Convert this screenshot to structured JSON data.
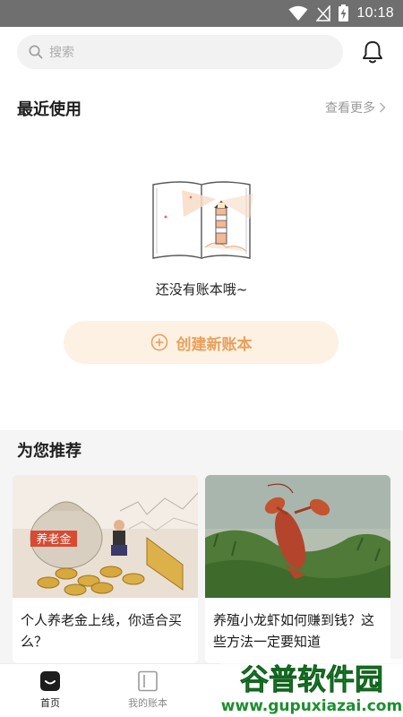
{
  "status_bar": {
    "time": "10:18"
  },
  "search": {
    "placeholder": "搜索"
  },
  "recent": {
    "title": "最近使用",
    "more_label": "查看更多"
  },
  "empty_state": {
    "message": "还没有账本哦~"
  },
  "create_button": {
    "label": "创建新账本"
  },
  "recommend": {
    "title": "为您推荐",
    "cards": [
      {
        "caption": "个人养老金上线，你适合买么？",
        "image_text": "养老金"
      },
      {
        "caption": "养殖小龙虾如何赚到钱？这些方法一定要知道"
      }
    ]
  },
  "tabs": [
    {
      "label": "首页",
      "active": true
    },
    {
      "label": "我的账本",
      "active": false
    }
  ],
  "watermark": {
    "title": "谷普软件园",
    "url": "www.gupuxiazai.com"
  },
  "colors": {
    "accent": "#e9a05e",
    "button_bg": "#fdf1e3",
    "status_bar": "#6f6f6f"
  }
}
